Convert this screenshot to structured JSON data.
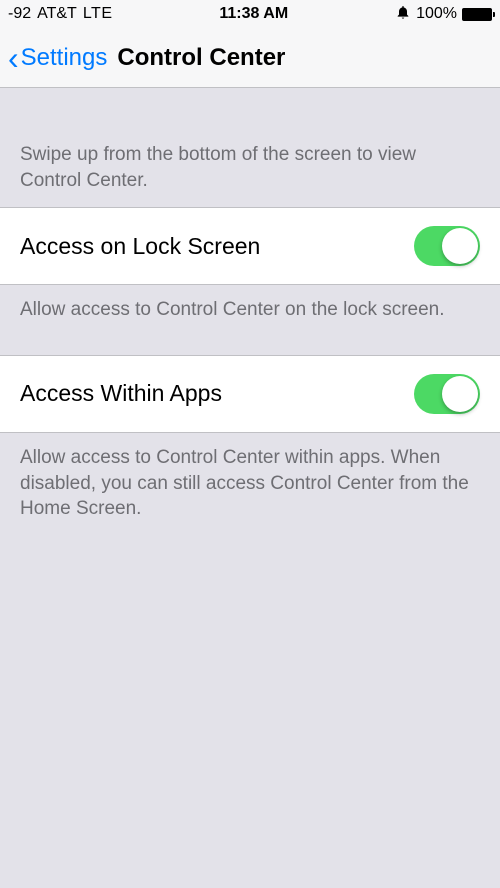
{
  "statusBar": {
    "signal": "-92",
    "carrier": "AT&T",
    "network": "LTE",
    "time": "11:38 AM",
    "alarmIcon": "⏰",
    "batteryPercent": "100%"
  },
  "nav": {
    "backLabel": "Settings",
    "title": "Control Center"
  },
  "intro": "Swipe up from the bottom of the screen to view Control Center.",
  "rows": [
    {
      "label": "Access on Lock Screen",
      "footer": "Allow access to Control Center on the lock screen.",
      "on": true
    },
    {
      "label": "Access Within Apps",
      "footer": "Allow access to Control Center within apps. When disabled, you can still access Control Center from the Home Screen.",
      "on": true
    }
  ]
}
